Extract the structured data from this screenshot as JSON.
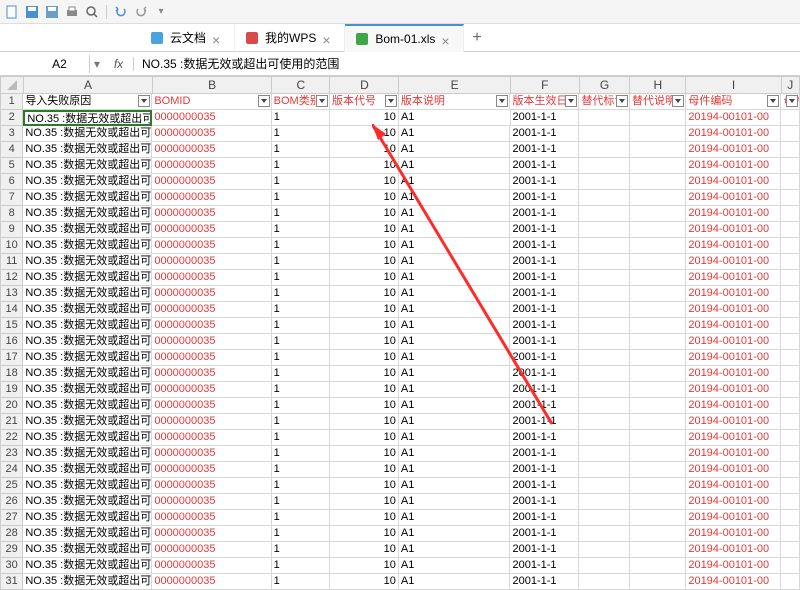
{
  "toolbar_icons": [
    "new",
    "save",
    "saveas",
    "print",
    "preview",
    "undo",
    "redo"
  ],
  "tabs": [
    {
      "icon": "cloud",
      "icon_color": "#4aa3df",
      "label": "云文档",
      "close": true,
      "active": false
    },
    {
      "icon": "wps",
      "icon_color": "#d94a4a",
      "label": "我的WPS",
      "close": true,
      "active": false
    },
    {
      "icon": "xls",
      "icon_color": "#3fa648",
      "label": "Bom-01.xls",
      "close": true,
      "active": true
    }
  ],
  "tab_add": "+",
  "cell_ref": "A2",
  "fx_symbol": "fx",
  "fx_value": "NO.35 :数据无效或超出可使用的范围",
  "col_letters": [
    "A",
    "B",
    "C",
    "D",
    "E",
    "F",
    "G",
    "H",
    "I",
    "J"
  ],
  "headers": [
    {
      "t": "导入失败原因",
      "red": false
    },
    {
      "t": "BOMID",
      "red": true
    },
    {
      "t": "BOM类别",
      "red": true
    },
    {
      "t": "版本代号",
      "red": true
    },
    {
      "t": "版本说明",
      "red": true
    },
    {
      "t": "版本生效日",
      "red": true
    },
    {
      "t": "替代标识",
      "red": true
    },
    {
      "t": "替代说明",
      "red": true
    },
    {
      "t": "母件编码",
      "red": true
    },
    {
      "t": "母件",
      "red": true
    }
  ],
  "row_template": {
    "A": "NO.35 :数据无效或超出可",
    "B": "0000000035",
    "C": "1",
    "D": "10",
    "E": "A1",
    "F": "2001-1-1",
    "G": "",
    "H": "",
    "I": "20194-00101-00"
  },
  "row_count": 30,
  "sel_cell_alt": "NO.35 :数据无效或超出可"
}
